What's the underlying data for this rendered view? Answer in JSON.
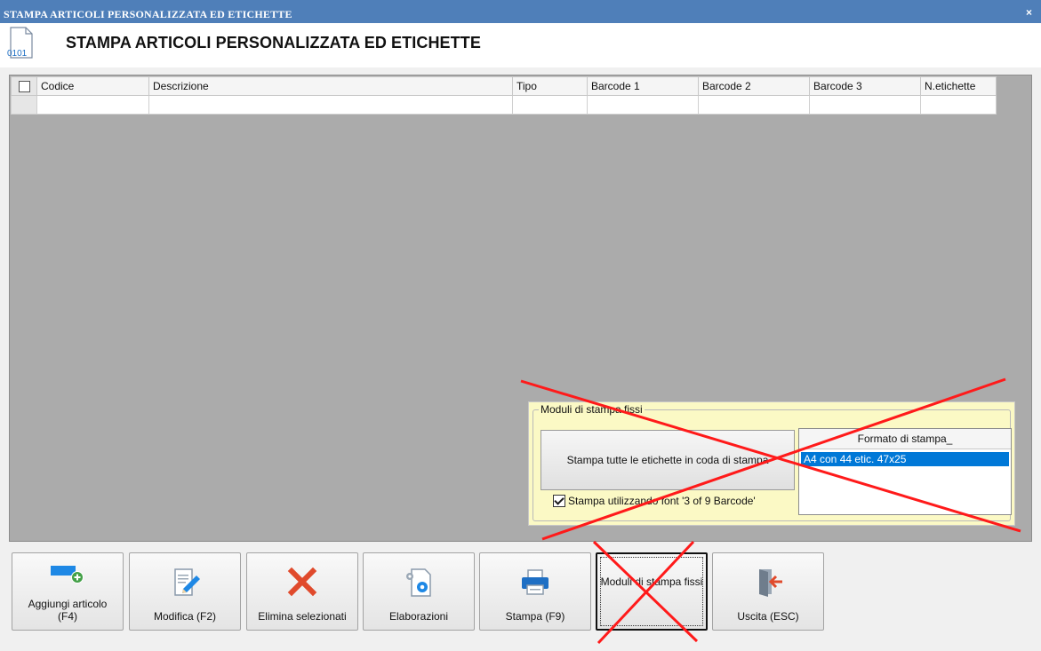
{
  "window": {
    "title": "STAMPA ARTICOLI PERSONALIZZATA ED ETICHETTE",
    "close_glyph": "×"
  },
  "header": {
    "icon_text": "0101",
    "heading": "STAMPA ARTICOLI PERSONALIZZATA ED ETICHETTE"
  },
  "grid": {
    "columns": [
      "Codice",
      "Descrizione",
      "Tipo",
      "Barcode 1",
      "Barcode 2",
      "Barcode 3",
      "N.etichette"
    ],
    "rows": [
      [
        "",
        "",
        "",
        "",
        "",
        "",
        ""
      ]
    ]
  },
  "moduli": {
    "group_title": "Moduli di stampa fissi",
    "print_all_label": "Stampa tutte le etichette in coda di stampa",
    "format_header": "Formato di stampa_",
    "formats": [
      "A4 con 44 etic. 47x25"
    ],
    "font_checkbox_label": "Stampa utilizzando font '3 of 9 Barcode'",
    "font_checkbox_checked": true
  },
  "toolbar": {
    "add_label": "Aggiungi articolo\n(F4)",
    "edit_label": "Modifica (F2)",
    "delete_label": "Elimina selezionati",
    "process_label": "Elaborazioni",
    "print_label": "Stampa (F9)",
    "modules_label": "Moduli di stampa fissi",
    "exit_label": "Uscita (ESC)"
  },
  "colors": {
    "titlebar": "#4f7fb9",
    "accent_blue": "#1e88e5",
    "delete_red": "#e04a2c",
    "annotation_red": "#ff1a1a",
    "panel_yellow": "#fbf9c5"
  },
  "icons": [
    "document-binary-icon",
    "add-article-icon",
    "edit-icon",
    "delete-x-icon",
    "gears-icon",
    "printer-icon",
    "exit-door-icon"
  ]
}
